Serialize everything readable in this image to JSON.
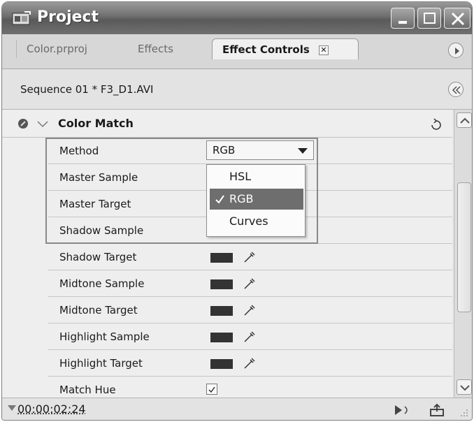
{
  "window": {
    "title": "Project"
  },
  "tabs": [
    {
      "label": "Color.prproj"
    },
    {
      "label": "Effects"
    },
    {
      "label": "Effect Controls",
      "active": true
    }
  ],
  "sequence": {
    "label": "Sequence 01 * F3_D1.AVI"
  },
  "effect": {
    "name": "Color Match",
    "expanded": true
  },
  "method": {
    "label": "Method",
    "value": "RGB"
  },
  "dropdown": {
    "options": [
      "HSL",
      "RGB",
      "Curves"
    ],
    "selected": "RGB"
  },
  "properties": [
    {
      "label": "Master Sample"
    },
    {
      "label": "Master Target"
    },
    {
      "label": "Shadow Sample"
    },
    {
      "label": "Shadow Target"
    },
    {
      "label": "Midtone Sample"
    },
    {
      "label": "Midtone Target"
    },
    {
      "label": "Highlight Sample"
    },
    {
      "label": "Highlight Target"
    }
  ],
  "match_hue": {
    "label": "Match Hue",
    "checked": true
  },
  "footer": {
    "timecode": "00:00:02:24"
  },
  "colors": {
    "swatch": "#333333",
    "title_bar": "#6e6e6e",
    "selection": "#6e6e6e"
  },
  "icons": [
    "app-icon",
    "minimize-icon",
    "maximize-icon",
    "close-icon",
    "panel-menu-icon",
    "collapse-icon",
    "fx-toggle-icon",
    "reset-icon",
    "eyedropper-icon",
    "play-audio-icon",
    "export-icon"
  ]
}
